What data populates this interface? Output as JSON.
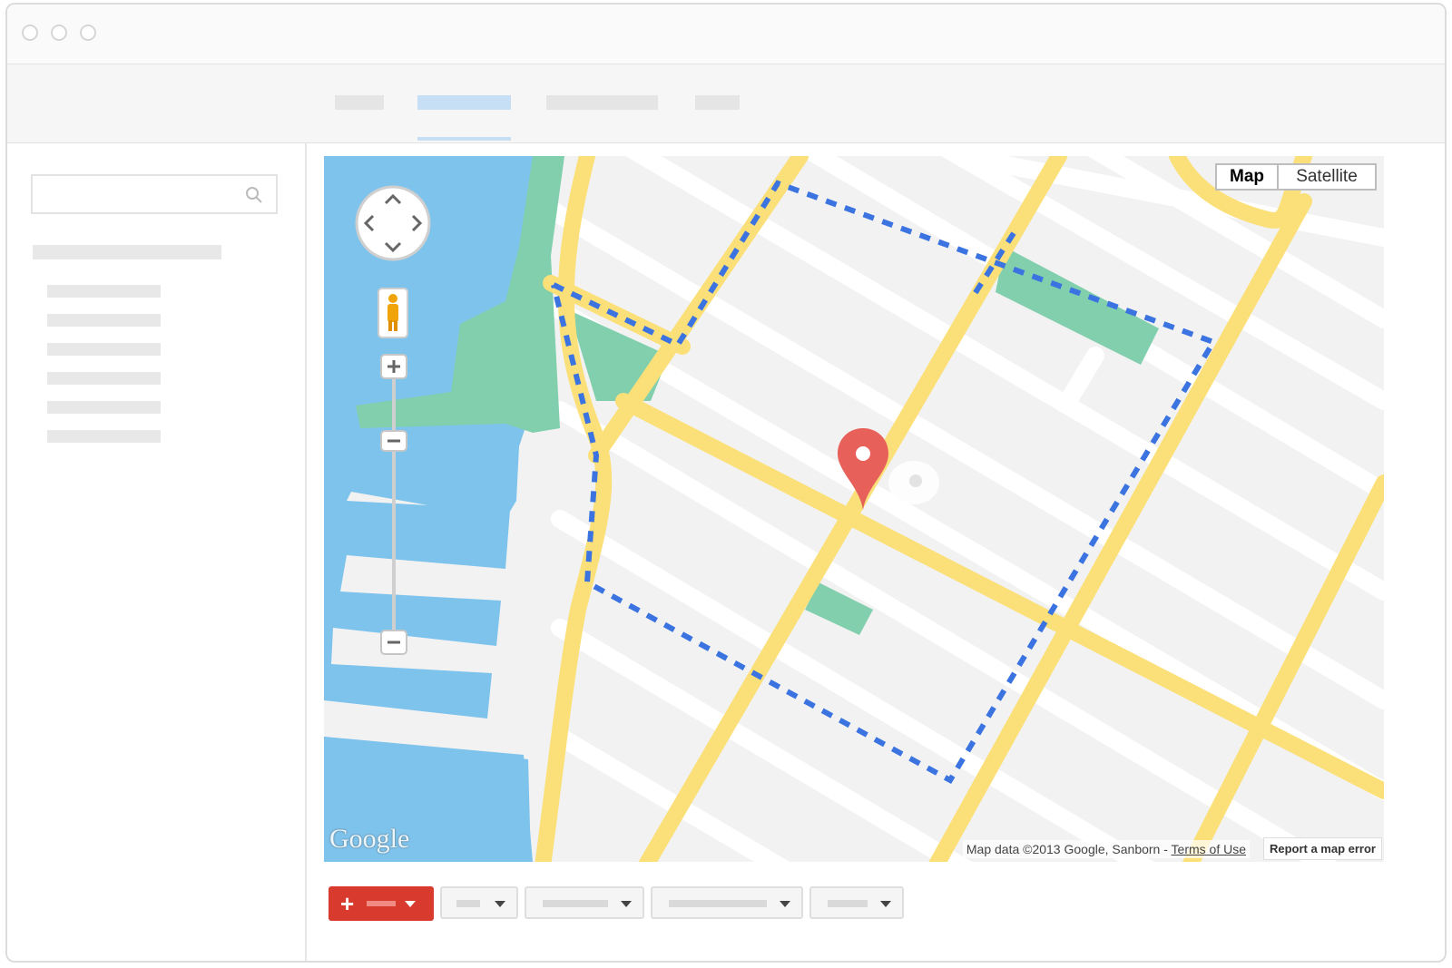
{
  "map": {
    "type_control": {
      "map_label": "Map",
      "satellite_label": "Satellite",
      "selected": "Map"
    },
    "attribution": {
      "prefix": "Map data ©2013 Google, Sanborn - ",
      "terms_label": "Terms of Use"
    },
    "report_label": "Report a map error",
    "logo_text": "Google",
    "icons": {
      "pan": "pan-control-icon",
      "pegman": "street-view-pegman-icon",
      "zoom_in": "zoom-in-icon",
      "zoom_out": "zoom-out-icon",
      "marker": "map-marker-icon"
    }
  },
  "colors": {
    "water": "#7ec3ec",
    "park": "#81cfad",
    "road": "#fbe07a",
    "route": "#3b73e0",
    "marker": "#e8605a",
    "create_button": "#d93a2e"
  }
}
